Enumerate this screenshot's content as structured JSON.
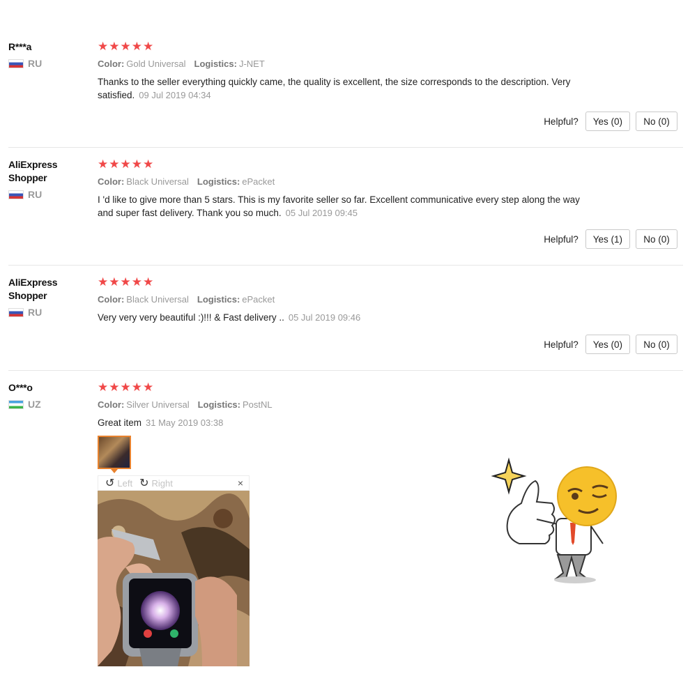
{
  "helpful_label": "Helpful?",
  "reviews": [
    {
      "user": "R***a",
      "country": "RU",
      "color_label": "Color:",
      "color": "Gold Universal",
      "logistics_label": "Logistics:",
      "logistics": "J-NET",
      "text": "Thanks to the seller everything quickly came, the quality is excellent, the size corresponds to the description. Very satisfied.",
      "date": "09 Jul 2019 04:34",
      "rating": 5,
      "yes": "Yes (0)",
      "no": "No (0)"
    },
    {
      "user": "AliExpress Shopper",
      "country": "RU",
      "color_label": "Color:",
      "color": "Black Universal",
      "logistics_label": "Logistics:",
      "logistics": "ePacket",
      "text": "I 'd like to give more than 5 stars. This is my favorite seller so far. Excellent communicative every step along the way and super fast delivery. Thank you so much.",
      "date": "05 Jul 2019 09:45",
      "rating": 5,
      "yes": "Yes (1)",
      "no": "No (0)"
    },
    {
      "user": "AliExpress Shopper",
      "country": "RU",
      "color_label": "Color:",
      "color": "Black Universal",
      "logistics_label": "Logistics:",
      "logistics": "ePacket",
      "text": "Very very very beautiful :)!!! & Fast delivery ..",
      "date": "05 Jul 2019 09:46",
      "rating": 5,
      "yes": "Yes (0)",
      "no": "No (0)"
    },
    {
      "user": "O***o",
      "country": "UZ",
      "color_label": "Color:",
      "color": "Silver Universal",
      "logistics_label": "Logistics:",
      "logistics": "PostNL",
      "text": "Great item",
      "date": "31 May 2019 03:38",
      "rating": 5
    }
  ],
  "image_viewer": {
    "left_label": "Left",
    "right_label": "Right",
    "close": "×"
  },
  "colors": {
    "star": "#f04848",
    "thumb_border": "#e8822e"
  }
}
